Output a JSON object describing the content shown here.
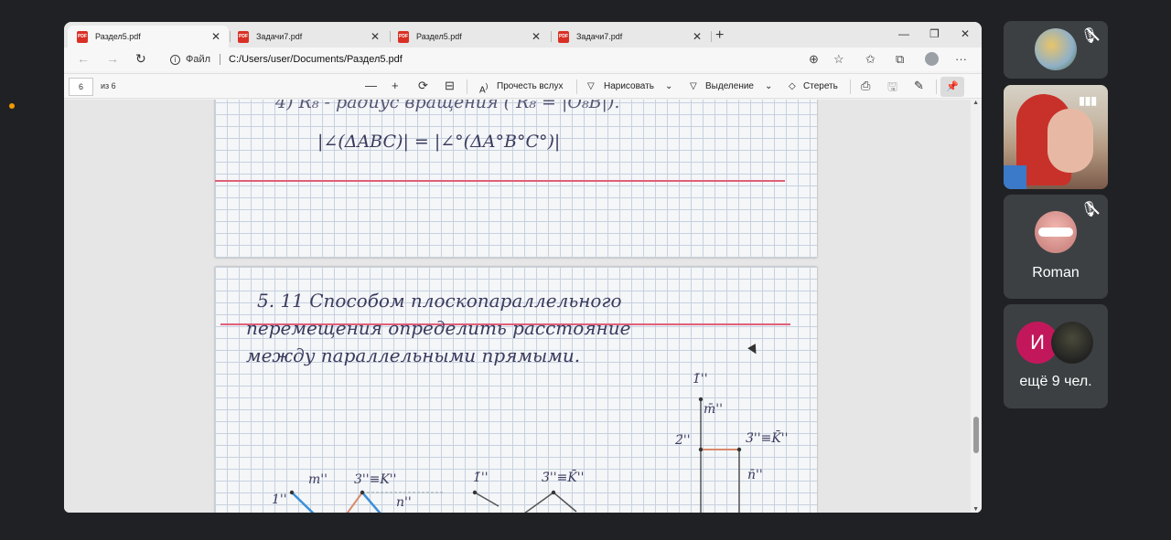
{
  "browser": {
    "tabs": [
      {
        "title": "Раздел5.pdf",
        "active": true
      },
      {
        "title": "Задачи7.pdf",
        "active": false
      },
      {
        "title": "Раздел5.pdf",
        "active": false
      },
      {
        "title": "Задачи7.pdf",
        "active": false
      }
    ],
    "tab_icon_text": "PDF",
    "tab_close": "✕",
    "new_tab": "+",
    "window_controls": {
      "minimize": "—",
      "restore": "❐",
      "close": "✕"
    },
    "address": {
      "site_label": "Файл",
      "url": "C:/Users/user/Documents/Раздел5.pdf"
    },
    "nav": {
      "back": "←",
      "forward": "→",
      "reload": "↻"
    },
    "addr_icons": {
      "zoom": "⊕",
      "favorite": "☆",
      "favorites": "✩",
      "collections": "⧉",
      "menu": "···"
    }
  },
  "pdf_toolbar": {
    "page_number": "6",
    "page_count": "из 6",
    "zoom_out": "—",
    "zoom_in": "+",
    "rotate": "⟳",
    "fit": "⊟",
    "read_aloud": "Прочесть вслух",
    "draw": "Нарисовать",
    "highlight": "Выделение",
    "erase": "Стереть",
    "print": "⎙",
    "save": "🖫",
    "save_as": "✎",
    "pin": "📌",
    "chevron": "⌄"
  },
  "document": {
    "page1_lines": [
      "4) R₈ - радиус вращения  ( R₈ = |O₈B|).",
      "|∠(ΔABC)| = |∠°(ΔA°B°C°)|"
    ],
    "page2_lines": [
      "5. 11   Способом   плоскопараллельного",
      "перемещения   определить   расстояние",
      "между   параллельными   прямыми."
    ],
    "drawing_labels": {
      "m": "m''",
      "one": "1''",
      "three_k": "3''≡K''",
      "n": "n''",
      "one_bar": "1̄''",
      "three_k_bar": "3̄''≡K̄''",
      "one_top": "1̄''",
      "m_bar": "m̄''",
      "two_bar": "2̄''",
      "three_k_right": "3̄''≡K̄''",
      "n_bar": "n̄''"
    }
  },
  "meet": {
    "participants": [
      {
        "name": "",
        "muted": true
      },
      {
        "name": "",
        "speaking": true
      },
      {
        "name": "Roman",
        "muted": true
      }
    ],
    "others_initial": "И",
    "others_label": "ещё 9 чел.",
    "mic_off_icon": "🎙̸",
    "colors": {
      "tile": "#3c4043",
      "initial_avatar": "#c2185b",
      "accent_dot": "#f29900"
    }
  }
}
